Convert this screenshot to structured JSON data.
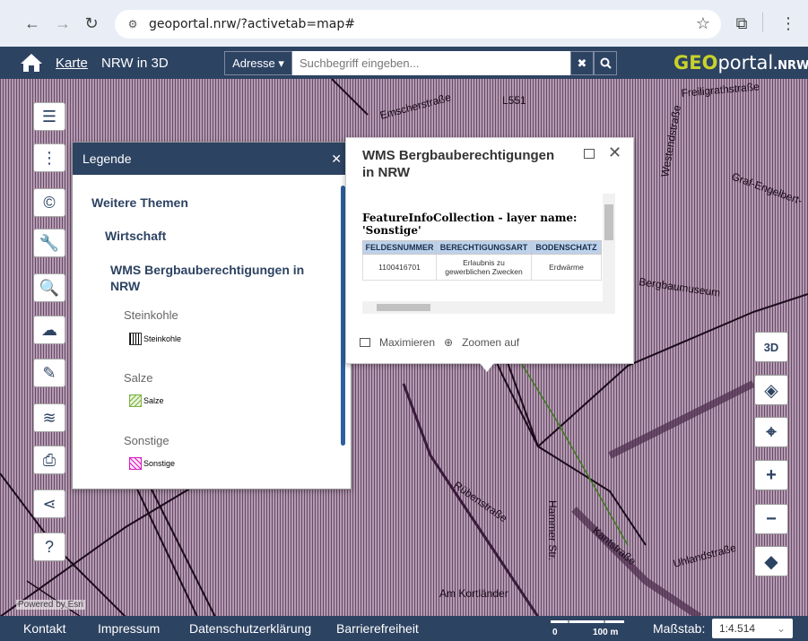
{
  "browser": {
    "url": "geoportal.nrw/?activetab=map#"
  },
  "header": {
    "tab_karte": "Karte",
    "tab_3d": "NRW in 3D",
    "address_button": "Adresse ▾",
    "search_placeholder": "Suchbegriff eingeben...",
    "logo_geo": "GEO",
    "logo_portal": "portal",
    "logo_nrw": ".NRW"
  },
  "map_labels": [
    "Emscherstraße",
    "L551",
    "Freiligrathstraße",
    "Westendstraße",
    "Graf-Engelbert-",
    "Bergbaumuseum",
    "Kantstraße",
    "Hammer Str.",
    "Uhlandstraße",
    "Am Kortländer",
    "Rübenstraße"
  ],
  "legend": {
    "title": "Legende",
    "section": "Weitere Themen",
    "group": "Wirtschaft",
    "layer": "WMS Bergbauberechtigungen in NRW",
    "items": [
      {
        "name": "Steinkohle",
        "label": "Steinkohle",
        "color": "#000000"
      },
      {
        "name": "Salze",
        "label": "Salze",
        "color": "#7cb342"
      },
      {
        "name": "Sonstige",
        "label": "Sonstige",
        "color": "#d81bc0"
      }
    ]
  },
  "popup": {
    "title": "WMS Bergbauberechtigungen in NRW",
    "feature_collection": "FeatureInfoCollection - layer name: 'Sonstige'",
    "columns": [
      "FELDESNUMMER",
      "BERECHTIGUNGSART",
      "BODENSCHATZ"
    ],
    "rows": [
      [
        "1100416701",
        "Erlaubnis zu gewerblichen Zwecken",
        "Erdwärme"
      ]
    ],
    "maximize_label": "Maximieren",
    "zoom_label": "Zoomen auf"
  },
  "footer": {
    "links": [
      "Kontakt",
      "Impressum",
      "Datenschutzerklärung",
      "Barrierefreiheit"
    ],
    "scale_0": "0",
    "scale_100": "100 m",
    "scale_label": "Maßstab:",
    "scale_value": "1:4.514"
  },
  "map_attribution": "Powered by Esri"
}
